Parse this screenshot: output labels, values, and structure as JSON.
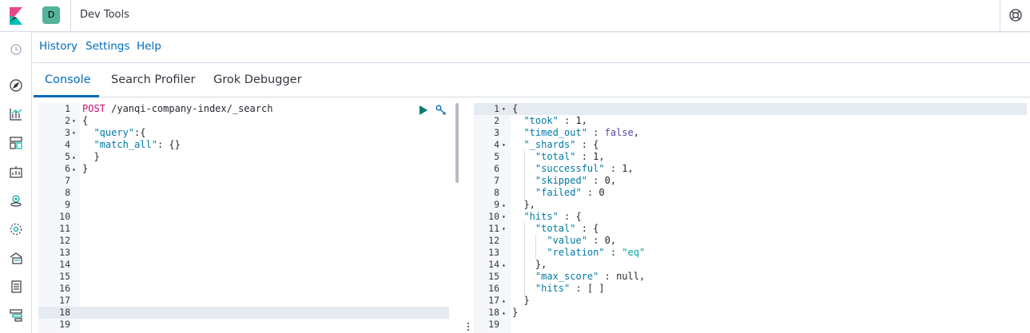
{
  "header": {
    "app_badge": "D",
    "app_title": "Dev Tools"
  },
  "menu": {
    "items": [
      "History",
      "Settings",
      "Help"
    ]
  },
  "tabs": {
    "items": [
      "Console",
      "Search Profiler",
      "Grok Debugger"
    ],
    "active_index": 0
  },
  "colors": {
    "accent": "#006bb8",
    "badge": "#54b399",
    "method": "#c80a68",
    "key": "#0079a5",
    "string": "#00a69b",
    "keyword": "#5a42a8"
  },
  "request_editor": {
    "line_numbers": [
      "1",
      "2",
      "3",
      "4",
      "5",
      "6",
      "7",
      "8",
      "9",
      "10",
      "11",
      "12",
      "13",
      "14",
      "15",
      "16",
      "17",
      "18",
      "19"
    ],
    "active_line": 18,
    "lines": [
      {
        "parts": [
          {
            "t": "POST",
            "c": "method"
          },
          {
            "t": " /yanqi-company-index/_search",
            "c": "url"
          }
        ]
      },
      {
        "parts": [
          {
            "t": "{",
            "c": "p"
          }
        ],
        "fold": "open"
      },
      {
        "parts": [
          {
            "t": "  ",
            "c": "p"
          },
          {
            "t": "\"query\"",
            "c": "key"
          },
          {
            "t": ":{",
            "c": "p"
          }
        ],
        "fold": "open"
      },
      {
        "parts": [
          {
            "t": "  ",
            "c": "p"
          },
          {
            "t": "\"match_all\"",
            "c": "key"
          },
          {
            "t": ": {}",
            "c": "p"
          }
        ]
      },
      {
        "parts": [
          {
            "t": "  }",
            "c": "p"
          }
        ],
        "fold": "close"
      },
      {
        "parts": [
          {
            "t": "}",
            "c": "p"
          }
        ],
        "fold": "close"
      }
    ],
    "actions": {
      "run": "play-icon",
      "settings": "wrench-icon"
    }
  },
  "response_editor": {
    "line_numbers": [
      "1",
      "2",
      "3",
      "4",
      "5",
      "6",
      "7",
      "8",
      "9",
      "10",
      "11",
      "12",
      "13",
      "14",
      "15",
      "16",
      "17",
      "18",
      "19"
    ],
    "active_line": 1,
    "lines": [
      {
        "parts": [
          {
            "t": "{",
            "c": "p"
          }
        ],
        "fold": "open"
      },
      {
        "parts": [
          {
            "t": "  ",
            "c": "p"
          },
          {
            "t": "\"took\"",
            "c": "key"
          },
          {
            "t": " : 1,",
            "c": "p"
          }
        ]
      },
      {
        "parts": [
          {
            "t": "  ",
            "c": "p"
          },
          {
            "t": "\"timed_out\"",
            "c": "key"
          },
          {
            "t": " : ",
            "c": "p"
          },
          {
            "t": "false",
            "c": "bool"
          },
          {
            "t": ",",
            "c": "p"
          }
        ]
      },
      {
        "parts": [
          {
            "t": "  ",
            "c": "p"
          },
          {
            "t": "\"_shards\"",
            "c": "key"
          },
          {
            "t": " : {",
            "c": "p"
          }
        ],
        "fold": "open"
      },
      {
        "parts": [
          {
            "t": "    ",
            "c": "p"
          },
          {
            "t": "\"total\"",
            "c": "key"
          },
          {
            "t": " : 1,",
            "c": "p"
          }
        ]
      },
      {
        "parts": [
          {
            "t": "    ",
            "c": "p"
          },
          {
            "t": "\"successful\"",
            "c": "key"
          },
          {
            "t": " : 1,",
            "c": "p"
          }
        ]
      },
      {
        "parts": [
          {
            "t": "    ",
            "c": "p"
          },
          {
            "t": "\"skipped\"",
            "c": "key"
          },
          {
            "t": " : 0,",
            "c": "p"
          }
        ]
      },
      {
        "parts": [
          {
            "t": "    ",
            "c": "p"
          },
          {
            "t": "\"failed\"",
            "c": "key"
          },
          {
            "t": " : 0",
            "c": "p"
          }
        ]
      },
      {
        "parts": [
          {
            "t": "  },",
            "c": "p"
          }
        ],
        "fold": "close"
      },
      {
        "parts": [
          {
            "t": "  ",
            "c": "p"
          },
          {
            "t": "\"hits\"",
            "c": "key"
          },
          {
            "t": " : {",
            "c": "p"
          }
        ],
        "fold": "open"
      },
      {
        "parts": [
          {
            "t": "    ",
            "c": "p"
          },
          {
            "t": "\"total\"",
            "c": "key"
          },
          {
            "t": " : {",
            "c": "p"
          }
        ],
        "fold": "open"
      },
      {
        "parts": [
          {
            "t": "      ",
            "c": "p"
          },
          {
            "t": "\"value\"",
            "c": "key"
          },
          {
            "t": " : 0,",
            "c": "p"
          }
        ]
      },
      {
        "parts": [
          {
            "t": "      ",
            "c": "p"
          },
          {
            "t": "\"relation\"",
            "c": "key"
          },
          {
            "t": " : ",
            "c": "p"
          },
          {
            "t": "\"eq\"",
            "c": "str"
          }
        ]
      },
      {
        "parts": [
          {
            "t": "    },",
            "c": "p"
          }
        ],
        "fold": "close"
      },
      {
        "parts": [
          {
            "t": "    ",
            "c": "p"
          },
          {
            "t": "\"max_score\"",
            "c": "key"
          },
          {
            "t": " : null,",
            "c": "p"
          }
        ]
      },
      {
        "parts": [
          {
            "t": "    ",
            "c": "p"
          },
          {
            "t": "\"hits\"",
            "c": "key"
          },
          {
            "t": " : [ ]",
            "c": "p"
          }
        ]
      },
      {
        "parts": [
          {
            "t": "  }",
            "c": "p"
          }
        ],
        "fold": "close"
      },
      {
        "parts": [
          {
            "t": "}",
            "c": "p"
          }
        ],
        "fold": "close"
      },
      {
        "parts": []
      }
    ]
  },
  "left_nav": {
    "icons": [
      "clock-icon",
      "compass-icon",
      "visualize-icon",
      "dashboard-icon",
      "canvas-icon",
      "maps-icon",
      "ml-icon",
      "infrastructure-icon",
      "logs-icon",
      "apm-icon"
    ]
  }
}
